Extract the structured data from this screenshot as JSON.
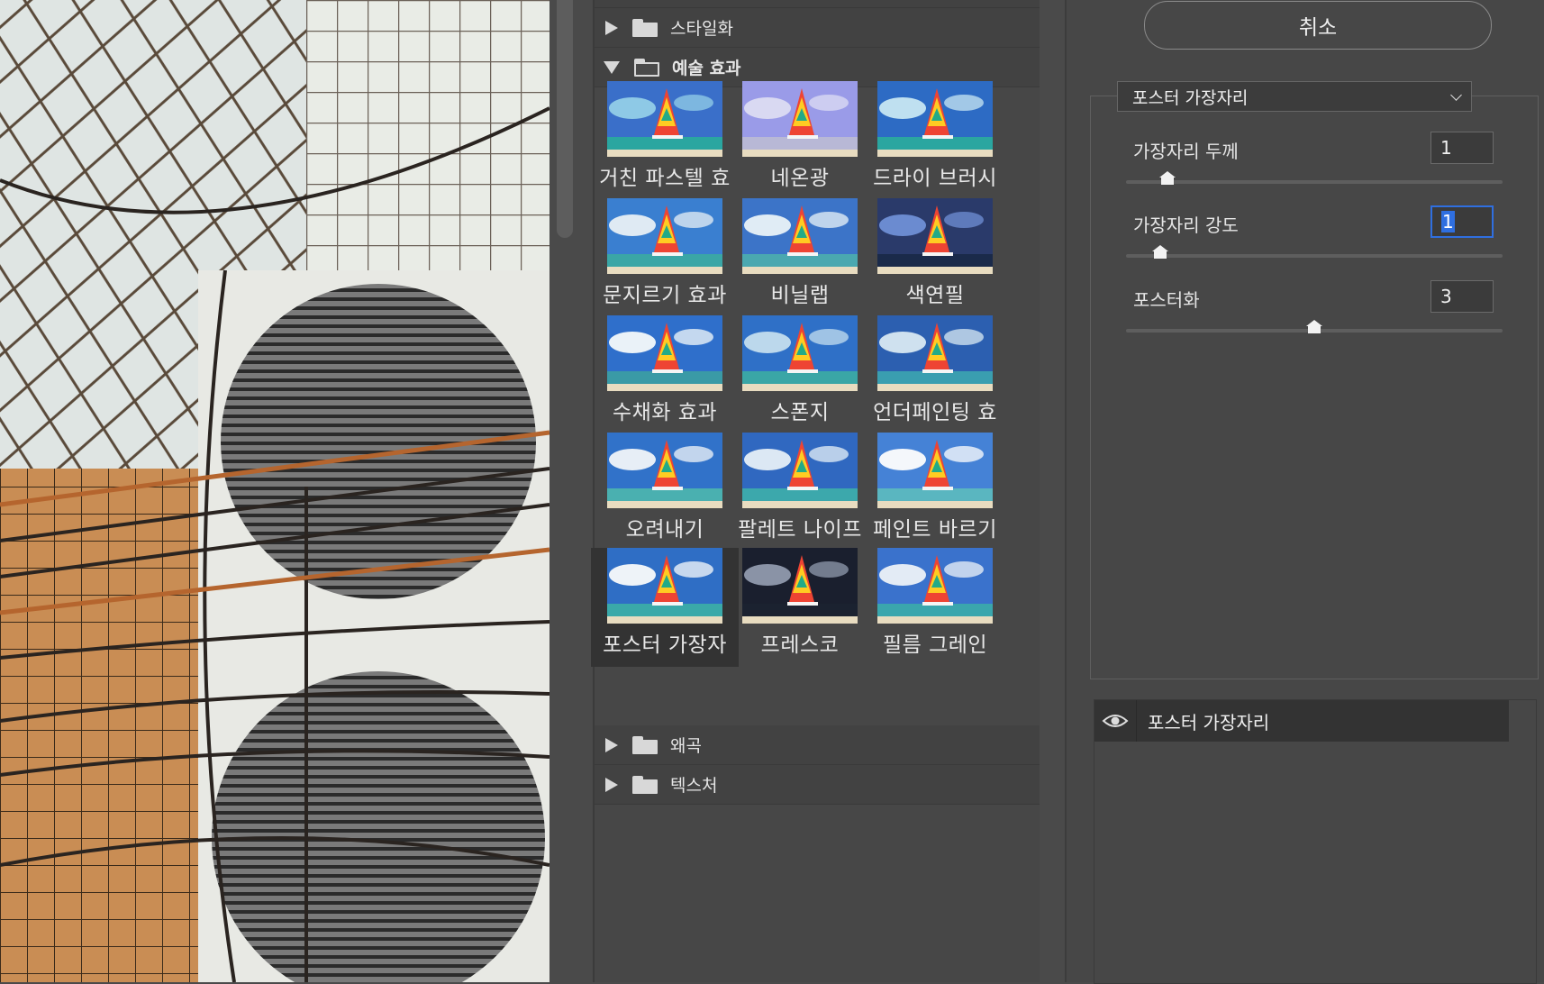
{
  "gallery": {
    "categories_top": [
      {
        "label": "스타일화",
        "expanded": false
      }
    ],
    "active_category": {
      "label": "예술 효과",
      "expanded": true
    },
    "filters": [
      {
        "label": "거친 파스텔 효"
      },
      {
        "label": "네온광"
      },
      {
        "label": "드라이 브러시"
      },
      {
        "label": "문지르기 효과"
      },
      {
        "label": "비닐랩"
      },
      {
        "label": "색연필"
      },
      {
        "label": "수채화 효과"
      },
      {
        "label": "스폰지"
      },
      {
        "label": "언더페인팅 효"
      },
      {
        "label": "오려내기"
      },
      {
        "label": "팔레트 나이프"
      },
      {
        "label": "페인트 바르기"
      },
      {
        "label": "포스터 가장자"
      },
      {
        "label": "프레스코"
      },
      {
        "label": "필름 그레인"
      }
    ],
    "selected_filter": "포스터 가장자",
    "categories_bottom": [
      {
        "label": "왜곡",
        "expanded": false
      },
      {
        "label": "텍스처",
        "expanded": false
      }
    ]
  },
  "settings": {
    "cancel_label": "취소",
    "filter_select": "포스터 가장자리",
    "params": [
      {
        "label": "가장자리 두께",
        "value": "1",
        "slider_fraction": 0.11,
        "focused": false
      },
      {
        "label": "가장자리 강도",
        "value": "1",
        "slider_fraction": 0.09,
        "focused": true
      },
      {
        "label": "포스터화",
        "value": "3",
        "slider_fraction": 0.5,
        "focused": false
      }
    ]
  },
  "layers": {
    "items": [
      {
        "name": "포스터 가장자리",
        "visible": true
      }
    ]
  },
  "colors": {
    "panel_bg": "#474747",
    "selected_bg": "#333333",
    "focus_blue": "#2f6fe0"
  }
}
